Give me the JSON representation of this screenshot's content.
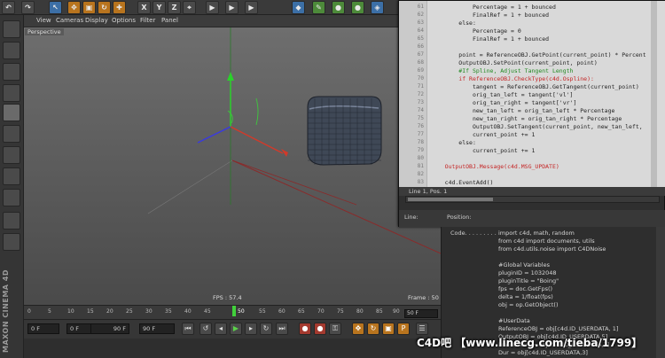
{
  "viewport": {
    "menu": [
      "View",
      "Cameras",
      "Display",
      "Options",
      "Filter",
      "Panel"
    ],
    "camera_label": "Perspective",
    "fps": "FPS : 57.4",
    "frame": "Frame : 50"
  },
  "timeline": {
    "ticks": [
      "0",
      "5",
      "10",
      "15",
      "20",
      "25",
      "30",
      "35",
      "40",
      "45",
      "50",
      "55",
      "60",
      "65",
      "70",
      "75",
      "80",
      "85",
      "90"
    ],
    "current_frame": "50",
    "end_field": "50 F"
  },
  "transport": {
    "start": "0 F",
    "range_start": "0 F",
    "range_end": "90 F",
    "end": "90 F"
  },
  "editor": {
    "lines": [
      {
        "n": "",
        "t": "            Percentage = 1 + bounced"
      },
      {
        "n": "",
        "t": "            FinalRef = 1 + bounced"
      },
      {
        "n": "",
        "t": "        else:"
      },
      {
        "n": "",
        "t": "            Percentage = 0"
      },
      {
        "n": "",
        "t": "            FinalRef = 1 + bounced"
      },
      {
        "n": "",
        "t": ""
      },
      {
        "n": "",
        "t": "        point = ReferenceOBJ.GetPoint(current_point) * Percent"
      },
      {
        "n": "",
        "t": "        OutputOBJ.SetPoint(current_point, point)"
      },
      {
        "n": "",
        "t": "        #If Spline, Adjust Tangent Length"
      },
      {
        "n": "",
        "t": "        if ReferenceOBJ.CheckType(c4d.Ospline):"
      },
      {
        "n": "",
        "t": "            tangent = ReferenceOBJ.GetTangent(current_point)"
      },
      {
        "n": "",
        "t": "            orig_tan_left = tangent['vl']"
      },
      {
        "n": "",
        "t": "            orig_tan_right = tangent['vr']"
      },
      {
        "n": "",
        "t": "            new_tan_left = orig_tan_left * Percentage"
      },
      {
        "n": "",
        "t": "            new_tan_right = orig_tan_right * Percentage"
      },
      {
        "n": "",
        "t": "            OutputOBJ.SetTangent(current_point, new_tan_left,"
      },
      {
        "n": "",
        "t": "            current_point += 1"
      },
      {
        "n": "",
        "t": "        else:"
      },
      {
        "n": "",
        "t": "            current_point += 1"
      },
      {
        "n": "",
        "t": ""
      },
      {
        "n": "",
        "t": "    OutputOBJ.Message(c4d.MSG_UPDATE)"
      },
      {
        "n": "",
        "t": ""
      },
      {
        "n": "",
        "t": "    c4d.EventAdd()"
      }
    ],
    "line_pos": "Line 1, Pos. 1",
    "line_label": "Line:",
    "position_label": "Position:"
  },
  "attributes": {
    "code_label": "Code. . . . . . . . .",
    "lines": [
      "import c4d, math, random",
      "from c4d import documents, utils",
      "from c4d.utils.noise import C4DNoise",
      "",
      "#Global Variables",
      "pluginID = 1032048",
      "pluginTitle = \"Boing\"",
      "fps = doc.GetFps()",
      "delta = 1/float(fps)",
      "obj = op.GetObject()",
      "",
      "#UserData",
      "ReferenceOBJ = obj[c4d.ID_USERDATA, 1]",
      "OutputOBJ = obj[c4d.ID_USERDATA,5]",
      "FrameStart = obj[c4d.ID_USERDATA,2]",
      "Dur = obj[c4d.ID_USERDATA,3]"
    ]
  },
  "watermark": "C4D吧 【www.linecg.com/tieba/1799】",
  "brand": "MAXON CINEMA 4D",
  "colors": {
    "accent_green": "#41d13b",
    "keyword_green": "#228a22",
    "constant_red": "#c42525"
  }
}
